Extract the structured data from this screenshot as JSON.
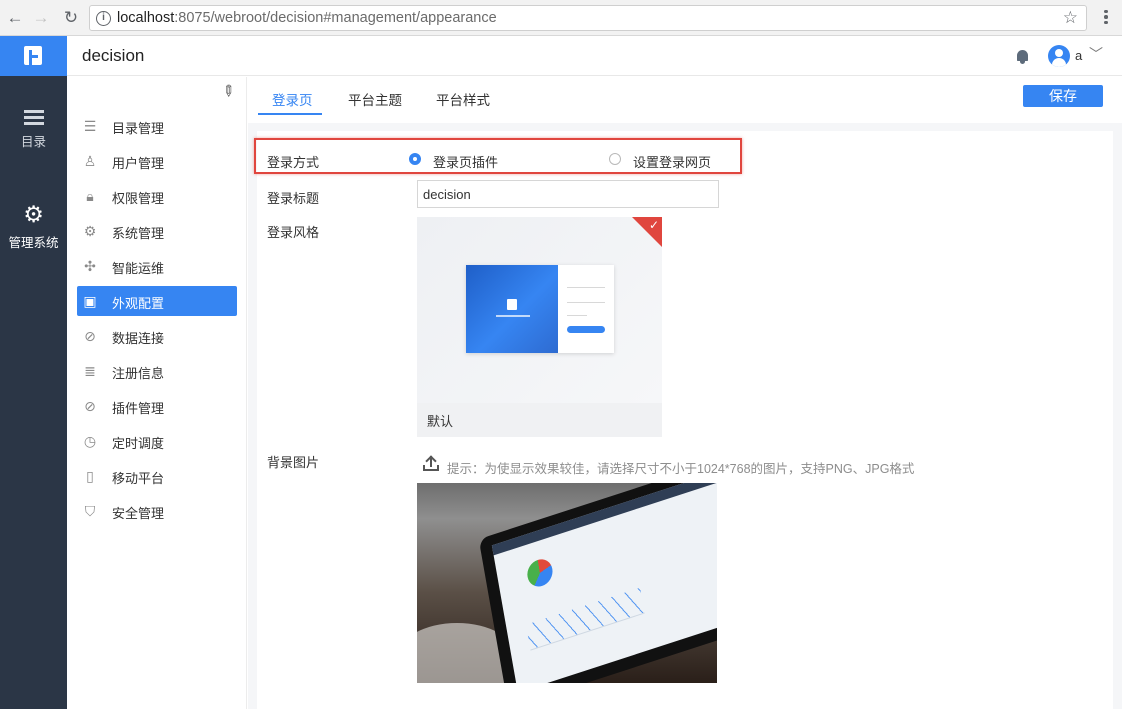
{
  "browser": {
    "back": "←",
    "forward": "→",
    "reload": "↻",
    "url_host": "localhost",
    "url_rest": ":8075/webroot/decision#management/appearance",
    "star": "☆"
  },
  "rail": {
    "catalog_label": "目录",
    "admin_label": "管理系统"
  },
  "header": {
    "title": "decision",
    "user": "a"
  },
  "sidebar": {
    "items": [
      {
        "label": "目录管理",
        "icon": "catalog-icon",
        "glyph": "☰"
      },
      {
        "label": "用户管理",
        "icon": "user-icon",
        "glyph": "♙"
      },
      {
        "label": "权限管理",
        "icon": "lock-icon",
        "glyph": "🔒︎"
      },
      {
        "label": "系统管理",
        "icon": "gear-icon",
        "glyph": "⚙"
      },
      {
        "label": "智能运维",
        "icon": "network-icon",
        "glyph": "✣"
      },
      {
        "label": "外观配置",
        "icon": "appearance-icon",
        "glyph": "▣"
      },
      {
        "label": "数据连接",
        "icon": "link-icon",
        "glyph": "⊘"
      },
      {
        "label": "注册信息",
        "icon": "register-icon",
        "glyph": "≣"
      },
      {
        "label": "插件管理",
        "icon": "plugin-icon",
        "glyph": "⊘"
      },
      {
        "label": "定时调度",
        "icon": "timer-icon",
        "glyph": "◷"
      },
      {
        "label": "移动平台",
        "icon": "mobile-icon",
        "glyph": "▯"
      },
      {
        "label": "安全管理",
        "icon": "shield-icon",
        "glyph": "⛉"
      }
    ],
    "active_index": 5
  },
  "tabs": [
    {
      "label": "登录页",
      "active": true
    },
    {
      "label": "平台主题",
      "active": false
    },
    {
      "label": "平台样式",
      "active": false
    }
  ],
  "save_label": "保存",
  "form": {
    "login_method_label": "登录方式",
    "option_plugin": "登录页插件",
    "option_webpage": "设置登录网页",
    "selected_option": "登录页插件",
    "login_title_label": "登录标题",
    "login_title_value": "decision",
    "login_style_label": "登录风格",
    "style_name": "默认",
    "bg_image_label": "背景图片",
    "bg_hint": "提示：为使显示效果较佳，请选择尺寸不小于1024*768的图片，支持PNG、JPG格式"
  },
  "colors": {
    "accent": "#3685f2",
    "rail": "#2b3646",
    "highlight": "#e0463e"
  }
}
